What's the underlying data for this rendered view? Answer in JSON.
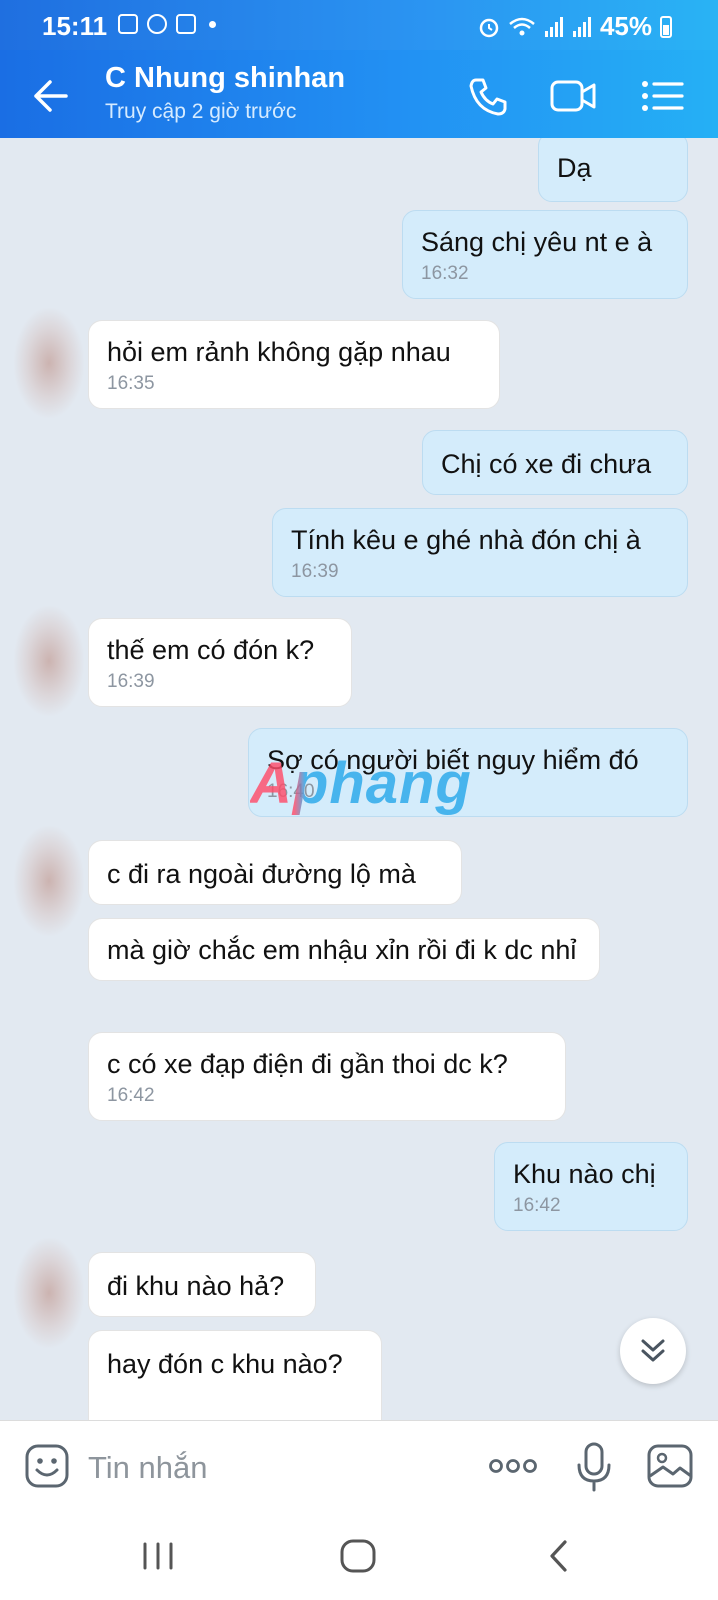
{
  "status_bar": {
    "time": "15:11",
    "battery": "45%"
  },
  "header": {
    "contact_name": "C Nhung shinhan",
    "contact_status": "Truy cập 2 giờ trước"
  },
  "messages": [
    {
      "dir": "out",
      "text": "Dạ",
      "time": ""
    },
    {
      "dir": "out",
      "text": "Sáng chị yêu nt e à",
      "time": "16:32"
    },
    {
      "dir": "in",
      "text": "hỏi em rảnh không gặp nhau",
      "time": "16:35"
    },
    {
      "dir": "out",
      "text": "Chị có xe đi chưa",
      "time": ""
    },
    {
      "dir": "out",
      "text": "Tính kêu e ghé nhà đón chị à",
      "time": "16:39"
    },
    {
      "dir": "in",
      "text": "thế em có đón k?",
      "time": "16:39"
    },
    {
      "dir": "out",
      "text": "Sợ có người biết nguy hiểm đó",
      "time": "16:40"
    },
    {
      "dir": "in",
      "text": "c đi ra ngoài đường lộ mà",
      "time": ""
    },
    {
      "dir": "in",
      "text": "mà giờ chắc em nhậu xỉn rồi đi k dc nhỉ",
      "time": ""
    },
    {
      "dir": "in",
      "text": "c có xe đạp điện đi gần thoi dc k?",
      "time": "16:42"
    },
    {
      "dir": "out",
      "text": "Khu nào chị",
      "time": "16:42"
    },
    {
      "dir": "in",
      "text": "đi khu nào hả?",
      "time": ""
    },
    {
      "dir": "in",
      "text": "hay đón c khu nào?",
      "time": ""
    }
  ],
  "watermark": "Aphang",
  "composer": {
    "placeholder": "Tin nhắn"
  },
  "colors": {
    "header": "#2290f3",
    "outgoing_bubble": "#d4ecfb",
    "incoming_bubble": "#ffffff",
    "chat_background": "#e2e9f1"
  },
  "icons": {
    "back": "arrow-left-icon",
    "call": "phone-icon",
    "video": "video-camera-icon",
    "menu": "list-menu-icon",
    "sticker": "sticker-face-icon",
    "more": "more-dots-icon",
    "mic": "microphone-icon",
    "image": "image-icon",
    "scroll": "double-chevron-down-icon"
  }
}
